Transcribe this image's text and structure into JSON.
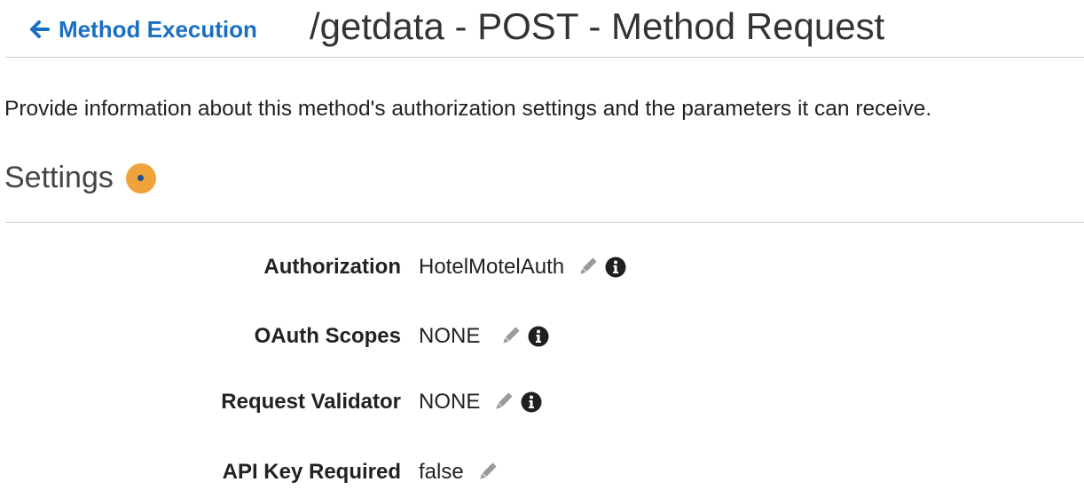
{
  "header": {
    "back_label": "Method Execution",
    "title": "/getdata - POST - Method Request"
  },
  "description": "Provide information about this method's authorization settings and the parameters it can receive.",
  "settings": {
    "heading": "Settings",
    "rows": [
      {
        "label": "Authorization",
        "value": "HotelMotelAuth"
      },
      {
        "label": "OAuth Scopes",
        "value": "NONE"
      },
      {
        "label": "Request Validator",
        "value": "NONE"
      },
      {
        "label": "API Key Required",
        "value": "false"
      }
    ]
  },
  "colors": {
    "link": "#1a6fc1",
    "settings_dot": "#f0a33a",
    "icon_gray": "#9a9a9a",
    "info_dark": "#1f1f1f"
  },
  "icons": {
    "back": "arrow-left-icon",
    "edit": "pencil-icon",
    "info": "info-icon"
  }
}
